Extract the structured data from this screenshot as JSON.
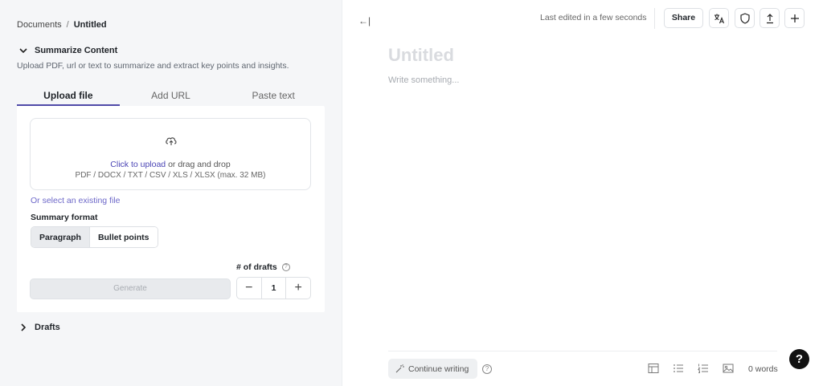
{
  "breadcrumb": {
    "root": "Documents",
    "separator": "/",
    "current": "Untitled"
  },
  "summarize": {
    "heading": "Summarize Content",
    "description": "Upload PDF, url or text to summarize and extract key points and insights.",
    "tabs": [
      "Upload file",
      "Add URL",
      "Paste text"
    ],
    "active_tab": "Upload file",
    "upload": {
      "link_text": "Click to upload",
      "rest_text": " or drag and drop",
      "formats": "PDF / DOCX / TXT / CSV / XLS / XLSX (max. 32 MB)"
    },
    "existing_file_link": "Or select an existing file",
    "format_label": "Summary format",
    "formats": [
      "Paragraph",
      "Bullet points"
    ],
    "selected_format": "Paragraph",
    "drafts_label": "# of drafts",
    "drafts_value": "1",
    "generate_label": "Generate",
    "stepper_minus": "−",
    "stepper_plus": "+"
  },
  "drafts_section": {
    "heading": "Drafts"
  },
  "editor": {
    "collapse_icon": "←|",
    "last_edited": "Last edited in a few seconds",
    "share_label": "Share",
    "title_placeholder": "Untitled",
    "body_placeholder": "Write something...",
    "continue_label": "Continue writing",
    "word_count": "0 words",
    "help_label": "?"
  },
  "colors": {
    "accent": "#4f4aa8",
    "link": "#4b45b5",
    "sidebar_bg": "#f5f6f8"
  }
}
